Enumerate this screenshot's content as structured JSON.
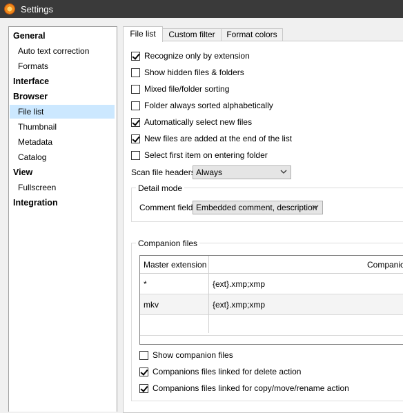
{
  "window": {
    "title": "Settings"
  },
  "tree": [
    {
      "label": "General",
      "level": 0
    },
    {
      "label": "Auto text correction",
      "level": 1
    },
    {
      "label": "Formats",
      "level": 1
    },
    {
      "label": "Interface",
      "level": 0
    },
    {
      "label": "Browser",
      "level": 0
    },
    {
      "label": "File list",
      "level": 1,
      "selected": true
    },
    {
      "label": "Thumbnail",
      "level": 1
    },
    {
      "label": "Metadata",
      "level": 1
    },
    {
      "label": "Catalog",
      "level": 1
    },
    {
      "label": "View",
      "level": 0
    },
    {
      "label": "Fullscreen",
      "level": 1
    },
    {
      "label": "Integration",
      "level": 0
    }
  ],
  "tabs": [
    {
      "label": "File list",
      "active": true
    },
    {
      "label": "Custom filter",
      "active": false
    },
    {
      "label": "Format colors",
      "active": false
    }
  ],
  "options": [
    {
      "label": "Recognize only by extension",
      "checked": true
    },
    {
      "label": "Show hidden files & folders",
      "checked": false
    },
    {
      "label": "Mixed file/folder sorting",
      "checked": false
    },
    {
      "label": "Folder always sorted alphabetically",
      "checked": false
    },
    {
      "label": "Automatically select new files",
      "checked": true
    },
    {
      "label": "New files are added at the end of the list",
      "checked": true
    },
    {
      "label": "Select first item on entering folder",
      "checked": false
    }
  ],
  "scan": {
    "label": "Scan file headers",
    "value": "Always"
  },
  "detail": {
    "title": "Detail mode",
    "comment_label": "Comment field",
    "comment_value": "Embedded comment, description"
  },
  "companion": {
    "title": "Companion files",
    "columns": [
      "Master extension",
      "Companion"
    ],
    "rows": [
      {
        "ext": "*",
        "companion": "{ext}.xmp;xmp"
      },
      {
        "ext": "mkv",
        "companion": "{ext}.xmp;xmp"
      },
      {
        "ext": "",
        "companion": ""
      }
    ],
    "options": [
      {
        "label": "Show companion files",
        "checked": false
      },
      {
        "label": "Companions files linked for delete action",
        "checked": true
      },
      {
        "label": "Companions files linked for copy/move/rename action",
        "checked": true
      }
    ]
  }
}
